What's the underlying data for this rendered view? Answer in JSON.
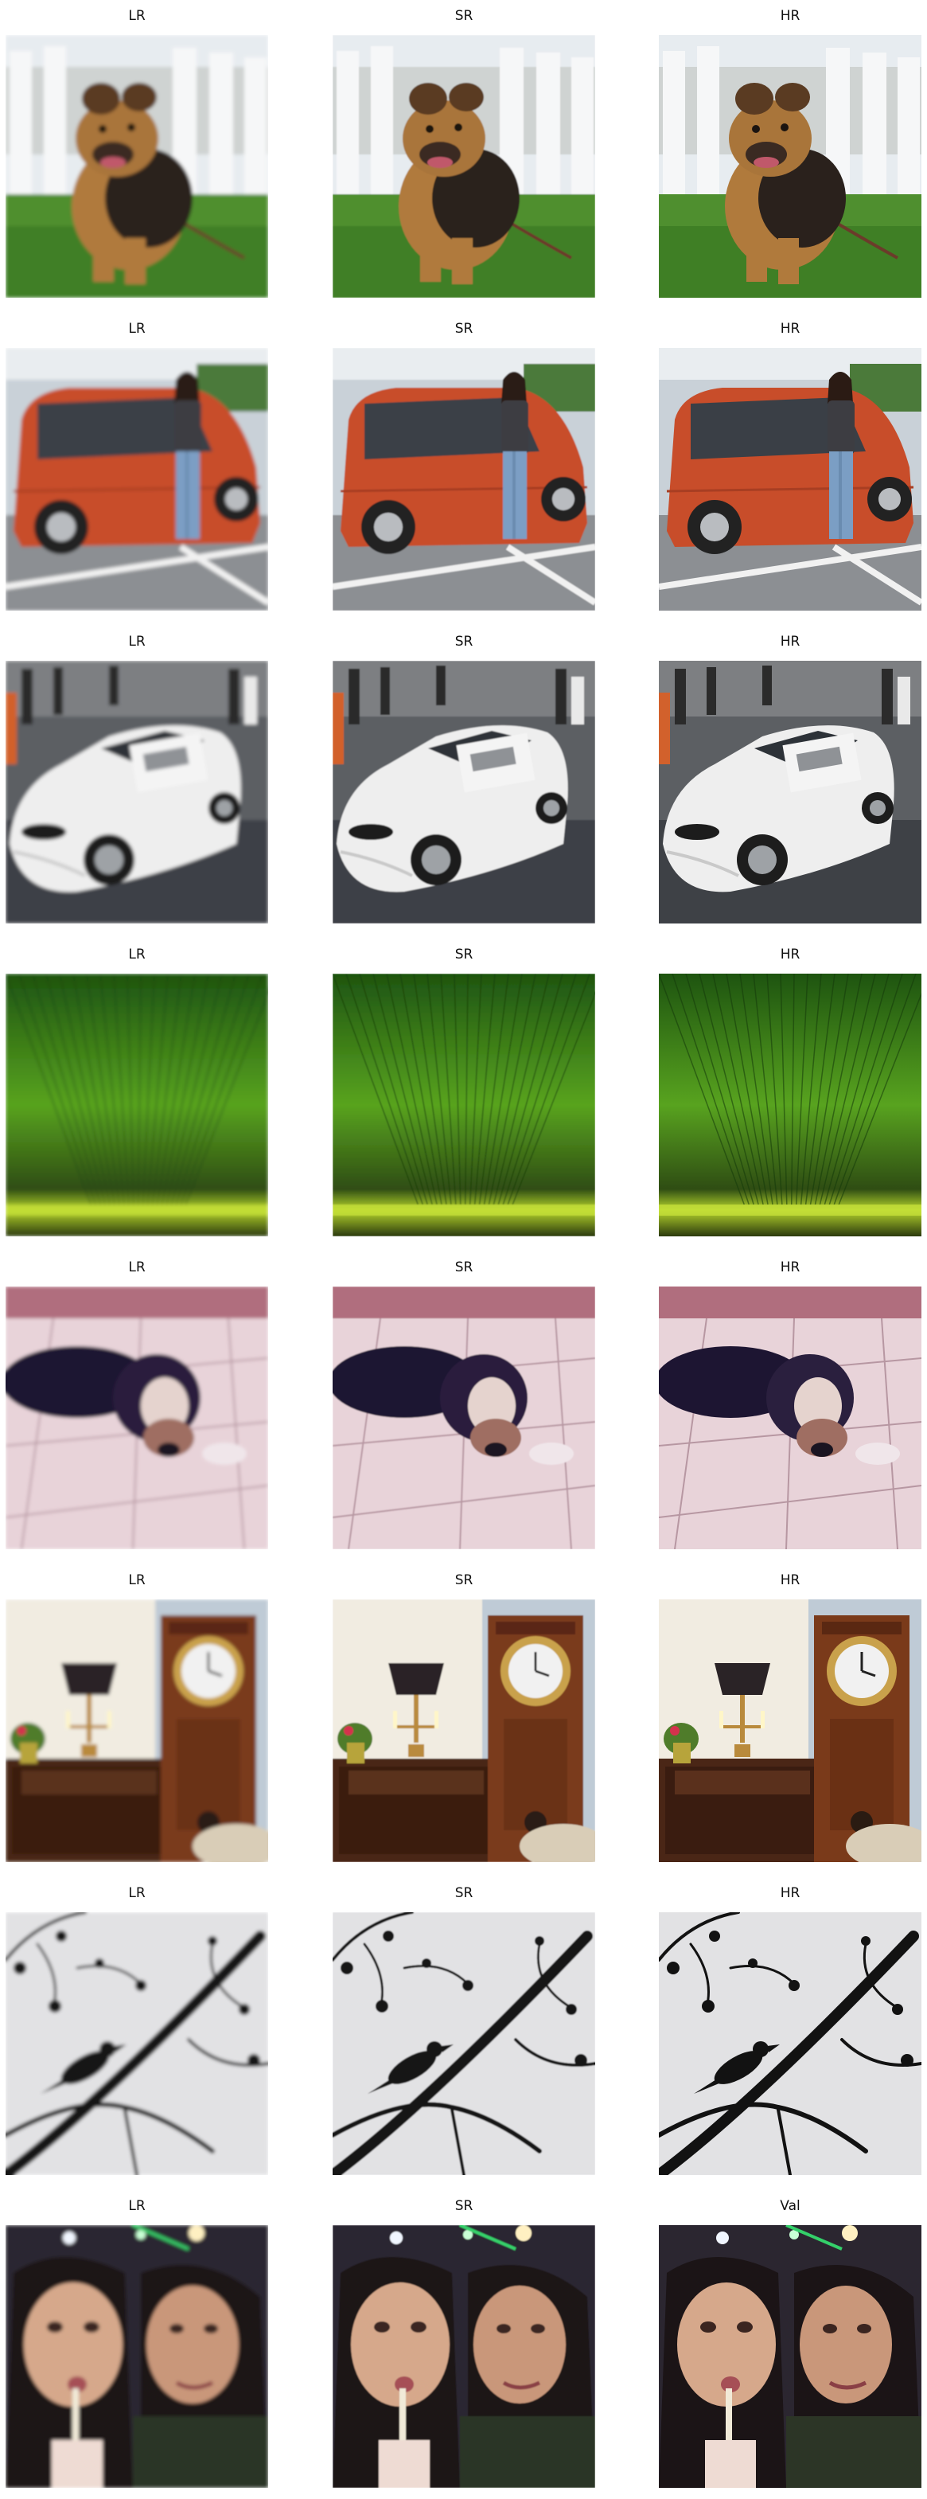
{
  "figure": {
    "rows": [
      {
        "subject": "dog-on-grass",
        "panels": [
          {
            "title": "LR"
          },
          {
            "title": "SR"
          },
          {
            "title": "HR"
          }
        ]
      },
      {
        "subject": "woman-with-red-car",
        "panels": [
          {
            "title": "LR"
          },
          {
            "title": "SR"
          },
          {
            "title": "HR"
          }
        ]
      },
      {
        "subject": "white-sports-car",
        "panels": [
          {
            "title": "LR"
          },
          {
            "title": "SR"
          },
          {
            "title": "HR"
          }
        ]
      },
      {
        "subject": "green-leaf",
        "panels": [
          {
            "title": "LR"
          },
          {
            "title": "SR"
          },
          {
            "title": "HR"
          }
        ]
      },
      {
        "subject": "sleeping-puppy",
        "panels": [
          {
            "title": "LR"
          },
          {
            "title": "SR"
          },
          {
            "title": "HR"
          }
        ]
      },
      {
        "subject": "clock-and-lamp-room",
        "panels": [
          {
            "title": "LR"
          },
          {
            "title": "SR"
          },
          {
            "title": "HR"
          }
        ]
      },
      {
        "subject": "bird-on-branch",
        "panels": [
          {
            "title": "LR"
          },
          {
            "title": "SR"
          },
          {
            "title": "HR"
          }
        ]
      },
      {
        "subject": "two-women-selfie",
        "panels": [
          {
            "title": "LR"
          },
          {
            "title": "SR"
          },
          {
            "title": "Val"
          }
        ]
      }
    ]
  }
}
